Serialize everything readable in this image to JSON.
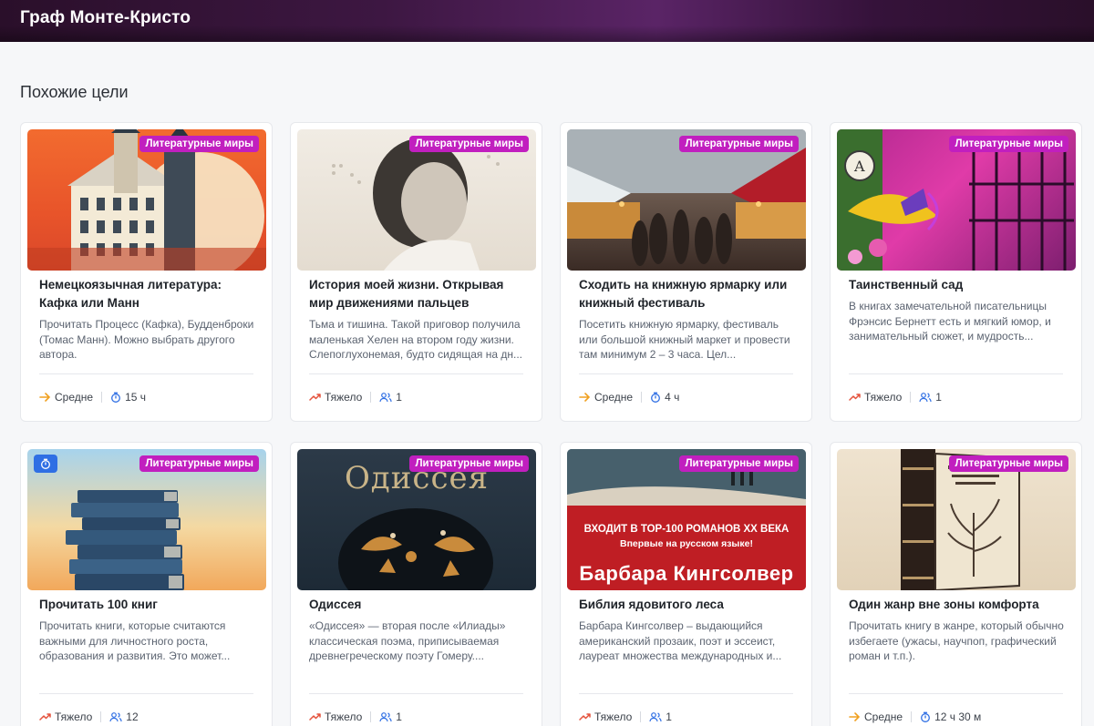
{
  "header": {
    "title": "Граф Монте-Кристо"
  },
  "section": {
    "title": "Похожие цели"
  },
  "cards": [
    {
      "category": "Литературные миры",
      "title": "Немецкоязычная литература: Кафка или Манн",
      "description": "Прочитать Процесс (Кафка), Будденброки (Томас Манн). Можно выбрать другого автора.",
      "difficulty": "Средне",
      "difficulty_icon": "arrow-right-icon",
      "stat": "15 ч",
      "stat_icon": "timer-icon"
    },
    {
      "category": "Литературные миры",
      "title": "История моей жизни. Открывая мир движениями пальцев",
      "description": "Тьма и тишина. Такой приговор получила маленькая Хелен на втором году жизни. Слепоглухонемая, будто сидящая на дн...",
      "difficulty": "Тяжело",
      "difficulty_icon": "trend-up-icon",
      "stat": "1",
      "stat_icon": "users-icon"
    },
    {
      "category": "Литературные миры",
      "title": "Сходить на книжную ярмарку или книжный фестиваль",
      "description": "Посетить книжную ярмарку, фестиваль или большой книжный маркет и провести там минимум 2 – 3 часа. Цел...",
      "difficulty": "Средне",
      "difficulty_icon": "arrow-right-icon",
      "stat": "4 ч",
      "stat_icon": "timer-icon"
    },
    {
      "category": "Литературные миры",
      "title": "Таинственный сад",
      "description": "В книгах замечательной писательницы Фрэнсис Бернетт есть и мягкий юмор, и занимательный сюжет, и мудрость...",
      "difficulty": "Тяжело",
      "difficulty_icon": "trend-up-icon",
      "stat": "1",
      "stat_icon": "users-icon"
    },
    {
      "category": "Литературные миры",
      "title": "Прочитать 100 книг",
      "description": "Прочитать книги, которые считаются важными для личностного роста, образования и развития. Это может...",
      "difficulty": "Тяжело",
      "difficulty_icon": "trend-up-icon",
      "stat": "12",
      "stat_icon": "users-icon",
      "timer_badge": true
    },
    {
      "category": "Литературные миры",
      "title": "Одиссея",
      "description": "«Одиссея» — вторая после «Илиады» классическая поэма, приписываемая древнегреческому поэту Гомеру....",
      "difficulty": "Тяжело",
      "difficulty_icon": "trend-up-icon",
      "stat": "1",
      "stat_icon": "users-icon",
      "cover_text": "Одиссея"
    },
    {
      "category": "Литературные миры",
      "title": "Библия ядовитого леса",
      "description": "Барбара Кингсолвер – выдающийся американский прозаик, поэт и эссеист, лауреат множества международных и...",
      "difficulty": "Тяжело",
      "difficulty_icon": "trend-up-icon",
      "stat": "1",
      "stat_icon": "users-icon",
      "cover_lines": [
        "ВХОДИТ В ТОР-100 РОМАНОВ XX ВЕКА",
        "Впервые на русском языке!",
        "Барбара Кингсолвер"
      ]
    },
    {
      "category": "Литературные миры",
      "title": "Один жанр вне зоны комфорта",
      "description": "Прочитать книгу в жанре, который обычно избегаете (ужасы, научпоп, графический роман и т.п.).",
      "difficulty": "Средне",
      "difficulty_icon": "arrow-right-icon",
      "stat": "12 ч 30 м",
      "stat_icon": "timer-icon"
    }
  ],
  "colors": {
    "badge": "#c11fbf",
    "medium": "#f0a020",
    "hard": "#e5533d",
    "stat_icon": "#2f6fe4"
  }
}
